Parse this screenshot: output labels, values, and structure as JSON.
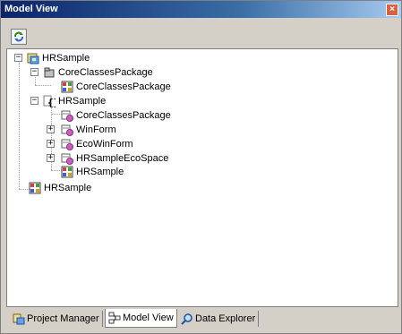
{
  "window": {
    "title": "Model View",
    "close_glyph": "×"
  },
  "toolbar": {
    "refresh_icon": "refresh-icon"
  },
  "tree": {
    "nodes": [
      {
        "label": "HRSample",
        "icon": "project-icon"
      },
      {
        "label": "CoreClassesPackage",
        "icon": "folder-icon"
      },
      {
        "label": "CoreClassesPackage",
        "icon": "diagram-icon"
      },
      {
        "label": "HRSample",
        "icon": "namespace-icon"
      },
      {
        "label": "CoreClassesPackage",
        "icon": "class-icon"
      },
      {
        "label": "WinForm",
        "icon": "class-icon"
      },
      {
        "label": "EcoWinForm",
        "icon": "class-icon"
      },
      {
        "label": "HRSampleEcoSpace",
        "icon": "class-icon"
      },
      {
        "label": "HRSample",
        "icon": "diagram-icon"
      },
      {
        "label": "HRSample",
        "icon": "diagram-icon"
      }
    ]
  },
  "tabs": [
    {
      "label": "Project Manager",
      "active": false
    },
    {
      "label": "Model View",
      "active": true
    },
    {
      "label": "Data Explorer",
      "active": false
    }
  ]
}
